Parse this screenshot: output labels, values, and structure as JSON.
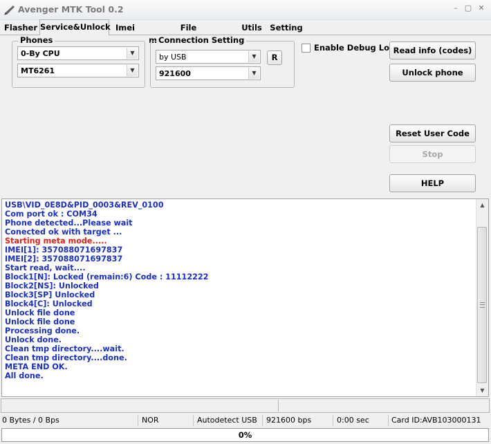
{
  "window": {
    "title": "Avenger MTK Tool 0.2",
    "minimize": "–",
    "maximize": "▢",
    "close": "✕"
  },
  "tabs": [
    {
      "label": "Flasher",
      "active": false
    },
    {
      "label": "Service&Unlock",
      "active": true
    },
    {
      "label": "Imei",
      "active": false
    },
    {
      "label": "File manager&Backup",
      "active": false
    },
    {
      "label": "Utils",
      "active": false
    },
    {
      "label": "Setting",
      "active": false
    }
  ],
  "phones": {
    "title": "Phones",
    "cpu": "0-By CPU",
    "model": "MT6261"
  },
  "connection": {
    "title": "Connection Setting",
    "mode": "by USB",
    "baud": "921600",
    "r_button": "R"
  },
  "debug": {
    "label": "Enable Debug Log",
    "checked": false
  },
  "buttons": {
    "read_info": "Read info (codes)",
    "unlock": "Unlock phone",
    "reset_user_code": "Reset User Code",
    "stop": "Stop",
    "help": "HELP"
  },
  "log": [
    {
      "text": "USB\\VID_0E8D&PID_0003&REV_0100",
      "color": "#1a2fc7"
    },
    {
      "text": "Com port ok : COM34",
      "color": "#1a2fc7"
    },
    {
      "text": "Phone detected...Please wait",
      "color": "#1a2fc7"
    },
    {
      "text": "Conected ok with target ...",
      "color": "#1a2fc7"
    },
    {
      "text": "Starting meta mode.....",
      "color": "#e0231a"
    },
    {
      "text": "IMEI[1]: 357088071697837",
      "color": "#1a2fc7"
    },
    {
      "text": "IMEI[2]: 357088071697837",
      "color": "#1a2fc7"
    },
    {
      "text": "Start read, wait....",
      "color": "#1a2fc7"
    },
    {
      "text": "Block1[N]: Locked (remain:6) Code : 11112222",
      "color": "#1a2fc7"
    },
    {
      "text": "Block2[NS]: Unlocked",
      "color": "#1a2fc7"
    },
    {
      "text": "Block3[SP] Unlocked",
      "color": "#1a2fc7"
    },
    {
      "text": "Block4[C]: Unlocked",
      "color": "#1a2fc7"
    },
    {
      "text": "Unlock file done",
      "color": "#1a2fc7"
    },
    {
      "text": "Unlock file done",
      "color": "#1a2fc7"
    },
    {
      "text": "Processing done.",
      "color": "#1a2fc7"
    },
    {
      "text": "Unlock done.",
      "color": "#1a2fc7"
    },
    {
      "text": "Clean tmp directory....wait.",
      "color": "#1a2fc7"
    },
    {
      "text": "Clean tmp directory....done.",
      "color": "#1a2fc7"
    },
    {
      "text": "META END OK.",
      "color": "#1a2fc7"
    },
    {
      "text": "All done.",
      "color": "#1a2fc7"
    }
  ],
  "status": {
    "transfer": "0 Bytes / 0 Bps",
    "flash_type": "NOR",
    "detect": "Autodetect USB",
    "baud": "921600 bps",
    "time": "0:00 sec",
    "card_id": "Card ID:AVB103000131"
  },
  "progress": {
    "percent": 0,
    "label": "0%"
  }
}
